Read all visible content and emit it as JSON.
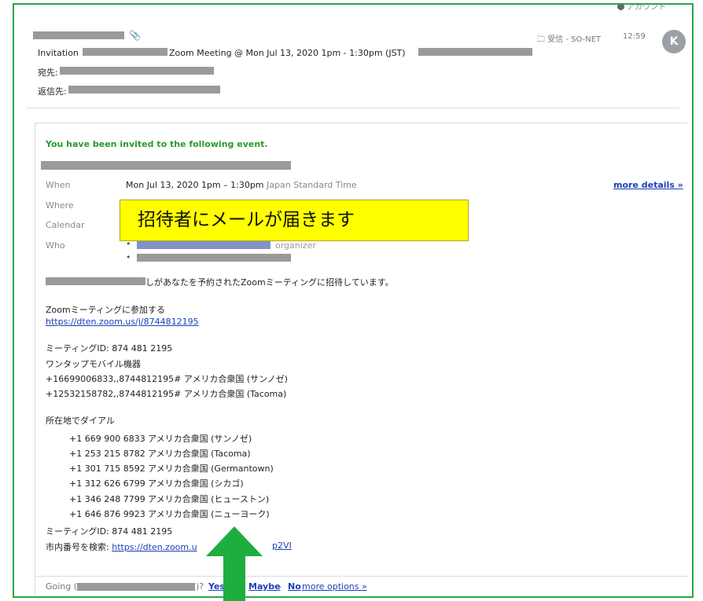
{
  "account_menu": {
    "label": "アカウント"
  },
  "header": {
    "subject_prefix": "Invitation",
    "subject_main": "Zoom Meeting @ Mon Jul 13, 2020 1pm - 1:30pm (JST)",
    "to_label": "宛先:",
    "reply_to_label": "返信先:",
    "folder_label": "受信 - SO-NET",
    "time": "12:59",
    "avatar_letter": "K"
  },
  "event": {
    "invited_text": "You have been invited to the following event.",
    "when_label": "When",
    "when_value": "Mon Jul 13, 2020 1pm – 1:30pm",
    "timezone": "Japan Standard Time",
    "where_label": "Where",
    "calendar_label": "Calendar",
    "who_label": "Who",
    "organizer_label": "organizer",
    "more_details": "more details »"
  },
  "callout": {
    "text": "招待者にメールが届きます"
  },
  "body": {
    "intro_suffix": "しがあなたを予約されたZoomミーティングに招待しています。",
    "join_heading": "Zoomミーティングに参加する",
    "join_link": "https://dten.zoom.us/j/8744812195",
    "meeting_id_1": "ミーティングID: 874 481 2195",
    "one_tap_heading": "ワンタップモバイル機器",
    "one_tap_1": "+16699006833,,8744812195# アメリカ合衆国 (サンノゼ)",
    "one_tap_2": "+12532158782,,8744812195# アメリカ合衆国 (Tacoma)",
    "dial_heading": "所在地でダイアル",
    "dial_numbers": [
      "+1 669 900 6833 アメリカ合衆国 (サンノゼ)",
      "+1 253 215 8782 アメリカ合衆国 (Tacoma)",
      "+1 301 715 8592 アメリカ合衆国 (Germantown)",
      "+1 312 626 6799 アメリカ合衆国 (シカゴ)",
      "+1 346 248 7799 アメリカ合衆国 (ヒューストン)",
      "+1 646 876 9923 アメリカ合衆国 (ニューヨーク)"
    ],
    "meeting_id_2": "ミーティングID: 874 481 2195",
    "local_number_label": "市内番号を検索:",
    "local_number_link_start": "https://dten.zoom.u",
    "local_number_link_end": "p2VI"
  },
  "rsvp": {
    "going_label": "Going (",
    "going_suffix": ")?",
    "yes": "Yes",
    "maybe": "Maybe",
    "no": "No",
    "sep": "-",
    "more_options": "more options »"
  },
  "colors": {
    "frame_border": "#2aa84a",
    "invited_green": "#2a9a2a",
    "link_blue": "#1a3fb8",
    "callout_yellow": "#ffff00",
    "arrow_green": "#1eae3e"
  }
}
